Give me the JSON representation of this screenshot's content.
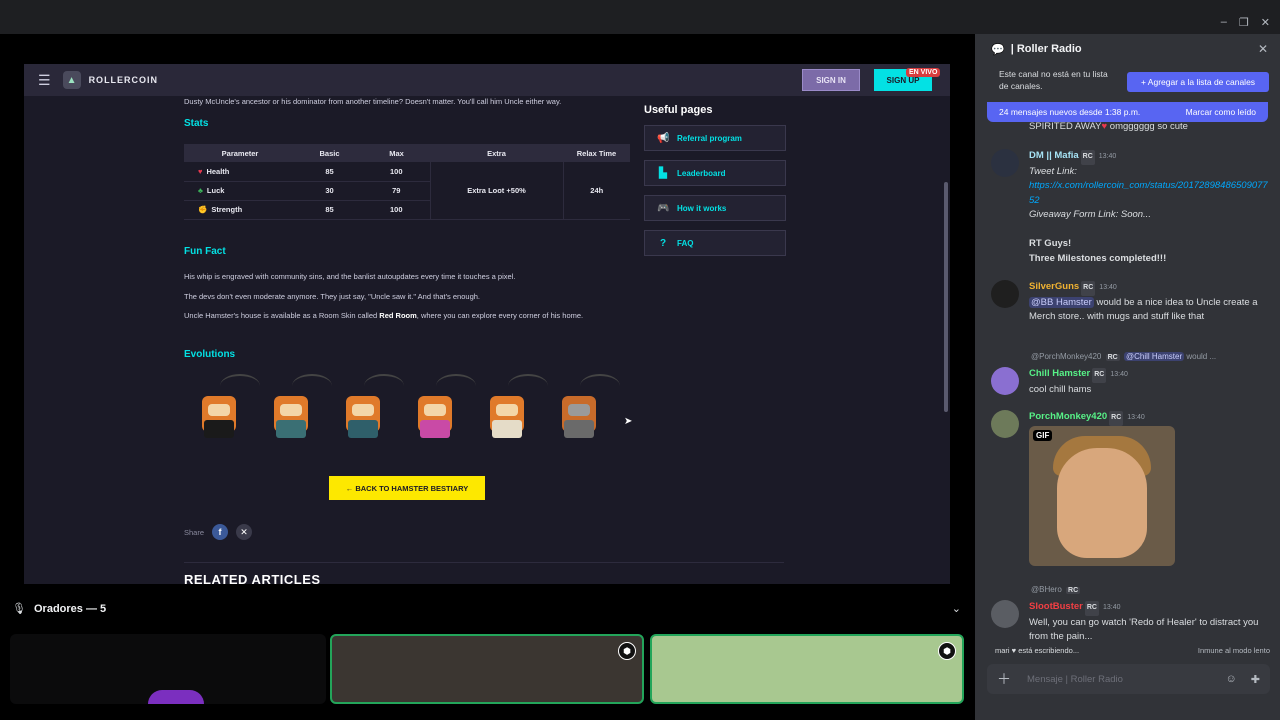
{
  "window": {
    "controls": [
      "–",
      "❐",
      "✕"
    ]
  },
  "site": {
    "brand": "ROLLERCOIN",
    "sign_in": "SIGN IN",
    "sign_up": "SIGN UP",
    "live": "EN VIVO",
    "intro": "Dusty McUncle's ancestor or his dominator from another timeline? Doesn't matter. You'll call him Uncle either way.",
    "stats_title": "Stats",
    "stats_headers": [
      "Parameter",
      "Basic",
      "Max",
      "Extra",
      "Relax Time"
    ],
    "stats_rows": [
      {
        "param": "Health",
        "basic": "85",
        "max": "100"
      },
      {
        "param": "Luck",
        "basic": "30",
        "max": "79"
      },
      {
        "param": "Strength",
        "basic": "85",
        "max": "100"
      }
    ],
    "extra": "Extra Loot +50%",
    "relax": "24h",
    "fun_fact_title": "Fun Fact",
    "facts": [
      "His whip is engraved with community sins, and the banlist autoupdates every time it touches a pixel.",
      "The devs don't even moderate anymore. They just say, \"Uncle saw it.\" And that's enough.",
      "Uncle Hamster's house is available as a Room Skin called "
    ],
    "fact3_bold": "Red Room",
    "fact3_tail": ", where you can explore every corner of his home.",
    "evolutions_title": "Evolutions",
    "back_button": "← BACK TO HAMSTER BESTIARY",
    "share_label": "Share",
    "related": "RELATED ARTICLES",
    "useful_title": "Useful pages",
    "useful_links": [
      "Referral program",
      "Leaderboard",
      "How it works",
      "FAQ"
    ]
  },
  "voice": {
    "speakers_label": "Oradores — 5"
  },
  "discord": {
    "channel_name": "| Roller Radio",
    "notice": "Este canal no está en tu lista de canales.",
    "add_button": "+ Agregar a la lista de canales",
    "new_messages": "24 mensajes nuevos desde 1:38 p.m.",
    "mark_read": "Marcar como leído",
    "prev_msg_tail": "SPIRITED AWAY",
    "prev_msg_text": " omgggggg so cute",
    "m1_user": "DM || Mafia",
    "m1_time": "13:40",
    "m1_label": "Tweet Link:",
    "m1_link": "https://x.com/rollercoin_com/status/2017289848650907752",
    "m1_form": "Giveaway Form Link: Soon...",
    "m1_line1": "RT Guys!",
    "m1_line2": "Three Milestones completed!!!",
    "m2_user": "SilverGuns",
    "m2_time": "13:40",
    "m2_mention": "@BB Hamster",
    "m2_text": " would be a nice idea to Uncle create a Merch store.. with mugs and stuff like that",
    "m3_reply_user": "@PorchMonkey420",
    "m3_reply_mention": "@Chill Hamster",
    "m3_reply_tail": " would ...",
    "m3_user": "Chill Hamster",
    "m3_time": "13:40",
    "m3_text": "cool chill hams",
    "m4_user": "PorchMonkey420",
    "m4_time": "13:40",
    "gif_label": "GIF",
    "m5_reply_user": "@BHero",
    "m5_user": "SlootBuster",
    "m5_time": "13:40",
    "m5_text": "Well, you can go watch 'Redo of Healer' to distract you from the pain...",
    "rc_tag": "RC",
    "typing": "mari ♥ está escribiendo...",
    "slowmode": "Inmune al modo lento",
    "composer_placeholder": "Mensaje  | Roller Radio"
  }
}
